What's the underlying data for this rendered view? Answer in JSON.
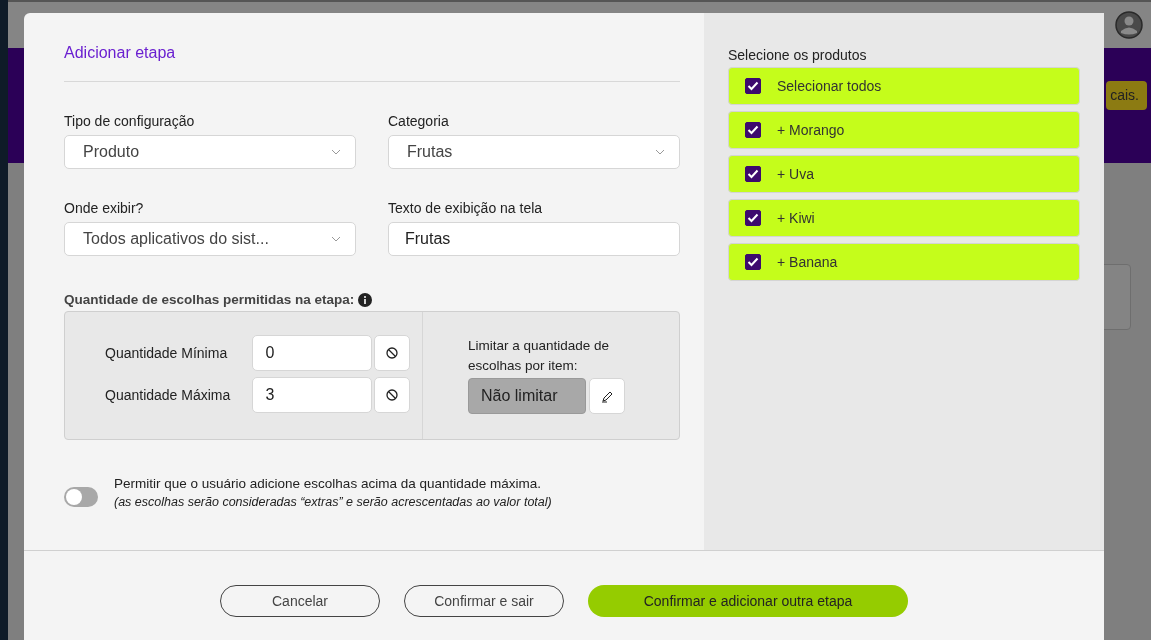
{
  "background_page": {
    "notice_button": "cais."
  },
  "dialog": {
    "title": "Adicionar etapa",
    "fields": [
      {
        "label": "Tipo de configuração",
        "kind": "select",
        "value": "Produto"
      },
      {
        "label": "Categoria",
        "kind": "select",
        "value": "Frutas"
      },
      {
        "label": "Onde exibir?",
        "kind": "select",
        "value": "Todos aplicativos do sist..."
      },
      {
        "label": "Texto de exibição na tela",
        "kind": "text",
        "value": "Frutas"
      }
    ],
    "quantity": {
      "label": "Quantidade de escolhas permitidas na etapa:",
      "limits": [
        {
          "label": "Quantidade Mínima",
          "value": "0"
        },
        {
          "label": "Quantidade Máxima",
          "value": "3"
        }
      ],
      "per_item": {
        "label": "Limitar a quantidade de escolhas por item:",
        "value": "Não limitar"
      }
    },
    "extras_toggle": {
      "on": false,
      "label": "Permitir que o usuário adicione escolhas acima da quantidade máxima.",
      "note": "(as escolhas serão consideradas “extras” e serão acrescentadas ao valor total)"
    },
    "products": {
      "title": "Selecione os produtos",
      "items": [
        {
          "label": "Selecionar todos",
          "checked": true
        },
        {
          "label": "+ Morango",
          "checked": true
        },
        {
          "label": "+ Uva",
          "checked": true
        },
        {
          "label": "+ Kiwi",
          "checked": true
        },
        {
          "label": "+ Banana",
          "checked": true
        }
      ]
    },
    "buttons": [
      {
        "label": "Cancelar",
        "kind": "secondary"
      },
      {
        "label": "Confirmar e sair",
        "kind": "secondary"
      },
      {
        "label": "Confirmar e adicionar outra etapa",
        "kind": "primary"
      }
    ]
  }
}
